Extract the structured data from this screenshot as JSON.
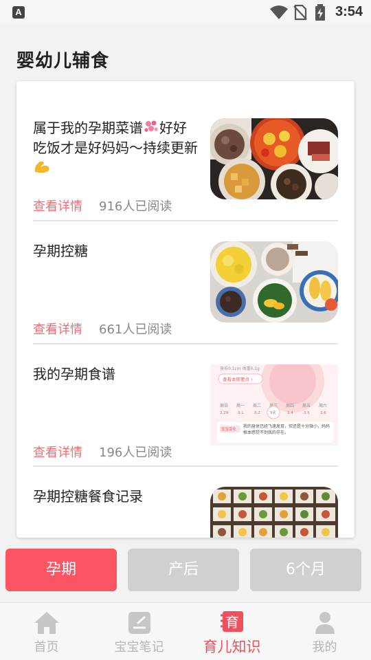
{
  "status_bar": {
    "app_badge": "A",
    "time": "3:54"
  },
  "page": {
    "title": "婴幼儿辅食"
  },
  "articles": [
    {
      "title": "属于我的孕期菜谱",
      "title_after_emoji": "好好吃饭才是好妈妈～持续更新",
      "link": "查看详情",
      "reads": "916人已阅读",
      "thumb": "food-plates-photo"
    },
    {
      "title": "孕期控糖",
      "link": "查看详情",
      "reads": "661人已阅读",
      "thumb": "meal-bowls-photo"
    },
    {
      "title": "我的孕期食谱",
      "link": "查看详情",
      "reads": "196人已阅读",
      "thumb": "app-screenshot-thumb",
      "thumb_text": {
        "top": "身长0.1cm 体重0.1g",
        "pill": "查看本周要点 ›",
        "days": [
          "周日",
          "周一",
          "周二",
          "周三",
          "周四",
          "周五",
          "周六"
        ],
        "dates": [
          "2.29",
          "3.1",
          "3.2",
          "9天",
          "3.4",
          "3.5",
          "3.6"
        ],
        "badge": "宝宝变化",
        "note": "我的身体已经飞速发育，但还是十分微小，妈妈根本感觉不到我的存在。"
      }
    },
    {
      "title": "孕期控糖餐食记录",
      "thumb": "meal-grid-photo"
    }
  ],
  "tabs": [
    {
      "label": "孕期",
      "active": true
    },
    {
      "label": "产后",
      "active": false
    },
    {
      "label": "6个月",
      "active": false
    }
  ],
  "nav": [
    {
      "label": "首页",
      "icon": "home-icon",
      "active": false
    },
    {
      "label": "宝宝笔记",
      "icon": "note-icon",
      "active": false
    },
    {
      "label": "育儿知识",
      "icon": "book-icon",
      "icon_text": "育",
      "active": true
    },
    {
      "label": "我的",
      "icon": "person-icon",
      "active": false
    }
  ],
  "colors": {
    "accent": "#fb5462",
    "link": "#f06b74",
    "inactive": "#d0d0d0"
  }
}
